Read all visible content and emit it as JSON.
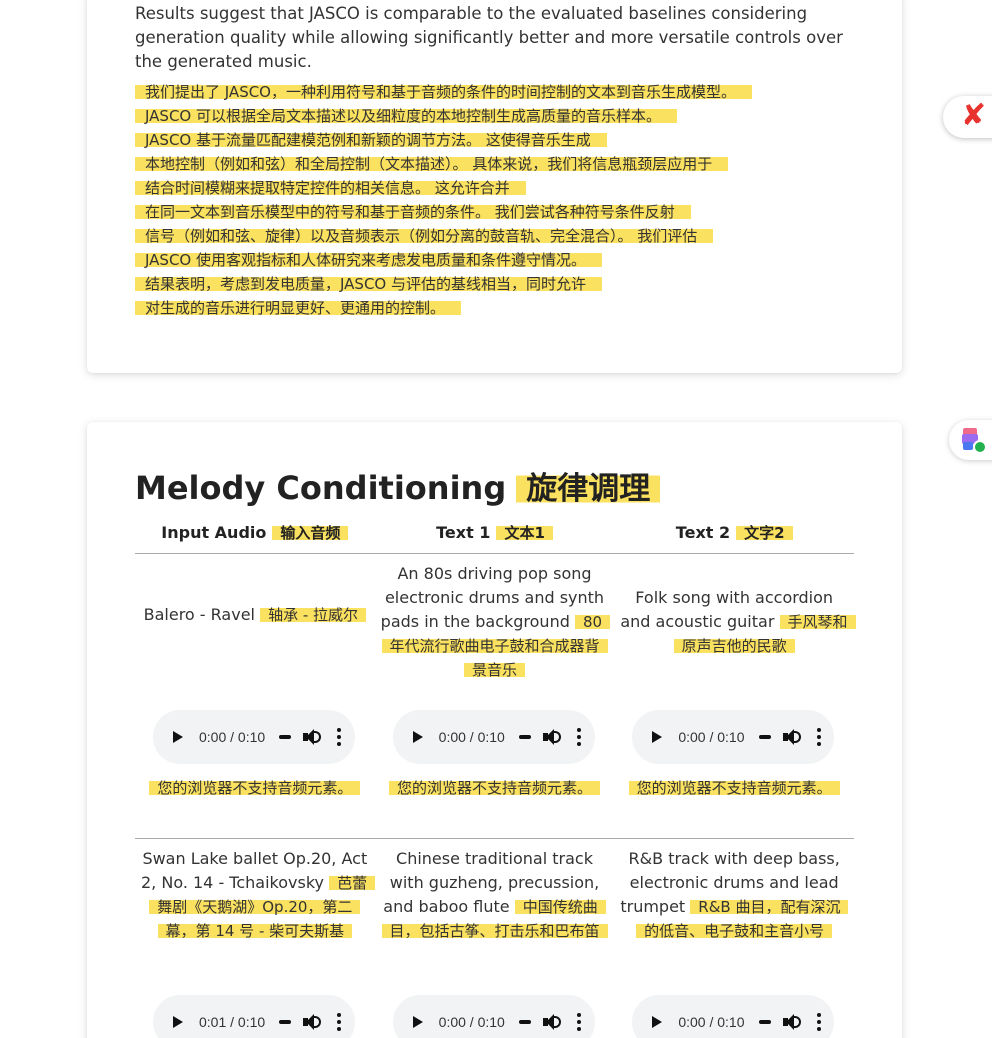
{
  "abstract": {
    "en_text": "Results suggest that JASCO is comparable to the evaluated baselines considering generation quality while allowing significantly better and more versatile controls over the generated music.",
    "cn_lines": [
      "我们提出了 JASCO，一种利用符号和基于音频的条件的时间控制的文本到音乐生成模型。",
      "JASCO 可以根据全局文本描述以及细粒度的本地控制生成高质量的音乐样本。",
      "JASCO 基于流量匹配建模范例和新颖的调节方法。 这使得音乐生成",
      "本地控制（例如和弦）和全局控制（文本描述）。 具体来说，我们将信息瓶颈层应用于",
      "结合时间模糊来提取特定控件的相关信息。 这允许合并",
      "在同一文本到音乐模型中的符号和基于音频的条件。 我们尝试各种符号条件反射",
      "信号（例如和弦、旋律）以及音频表示（例如分离的鼓音轨、完全混合）。 我们评估",
      "JASCO 使用客观指标和人体研究来考虑发电质量和条件遵守情况。",
      "结果表明，考虑到发电质量，JASCO 与评估的基线相当，同时允许",
      "对生成的音乐进行明显更好、更通用的控制。"
    ]
  },
  "section": {
    "title": "Melody Conditioning",
    "title_cn": "旋律调理",
    "headers": [
      {
        "en": "Input Audio",
        "cn": "输入音频"
      },
      {
        "en": "Text 1",
        "cn": "文本1"
      },
      {
        "en": "Text 2",
        "cn": "文字2"
      }
    ],
    "rows": [
      {
        "cells": [
          {
            "en": "Balero - Ravel",
            "cn": "轴承 - 拉威尔",
            "time": "0:00 / 0:10",
            "fallback": "您的浏览器不支持音频元素。"
          },
          {
            "en": "An 80s driving pop song electronic drums and synth pads in the background",
            "cn": "80 年代流行歌曲电子鼓和合成器背景音乐",
            "time": "0:00 / 0:10",
            "fallback": "您的浏览器不支持音频元素。"
          },
          {
            "en": "Folk song with accordion and acoustic guitar",
            "cn": "手风琴和原声吉他的民歌",
            "time": "0:00 / 0:10",
            "fallback": "您的浏览器不支持音频元素。"
          }
        ]
      },
      {
        "cells": [
          {
            "en": "Swan Lake ballet Op.20, Act 2, No. 14 - Tchaikovsky",
            "cn": "芭蕾舞剧《天鹅湖》Op.20，第二幕，第 14 号 - 柴可夫斯基",
            "time": "0:01 / 0:10"
          },
          {
            "en": "Chinese traditional track with guzheng, precussion, and baboo flute",
            "cn": "中国传统曲目，包括古筝、打击乐和巴布笛",
            "time": "0:00 / 0:10"
          },
          {
            "en": "R&B track with deep bass, electronic drums and lead trumpet",
            "cn": "R&B 曲目，配有深沉的低音、电子鼓和主音小号",
            "time": "0:00 / 0:10"
          }
        ]
      }
    ]
  },
  "colors": {
    "highlight": "#fbe160",
    "player_bg": "#f1f3f4",
    "ext_icon": "#e8322e"
  },
  "icons": [
    "play-icon",
    "mute-icon",
    "volume-icon",
    "more-options-icon",
    "translate-extension-icon",
    "doc-extension-icon"
  ]
}
